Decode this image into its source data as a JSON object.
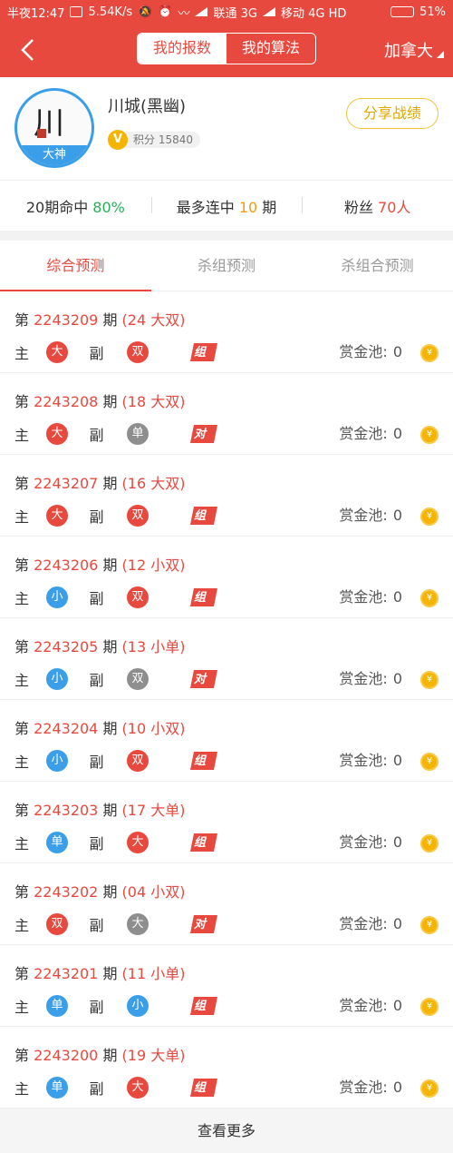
{
  "status_bar": {
    "time": "半夜12:47",
    "speed": "5.54K/s",
    "carrier1": "联通 3G",
    "carrier2": "移动 4G HD",
    "battery": "51%",
    "battery_level": 0.51
  },
  "navbar": {
    "tab_mine": "我的报数",
    "tab_algo": "我的算法",
    "region": "加拿大"
  },
  "profile": {
    "name": "川城(黑幽)",
    "avatar_tag": "大神",
    "avatar_art": "川",
    "badge": "V",
    "score_text": "积分 15840",
    "share": "分享战绩"
  },
  "stats": {
    "hit_prefix": "20期命中 ",
    "hit_value": "80%",
    "streak_prefix": "最多连中 ",
    "streak_value": "10",
    "streak_suffix": " 期",
    "fans_prefix": "粉丝 ",
    "fans_value": "70人"
  },
  "tabs": [
    "综合预测",
    "杀组预测",
    "杀组合预测"
  ],
  "labels": {
    "issue_prefix": "第 ",
    "issue_suffix": " 期",
    "main": "主",
    "vice": "副",
    "pool": "赏金池:",
    "coin": "¥"
  },
  "colors": {
    "red_ball": "#e8493f",
    "blue_ball": "#3a9fe8",
    "gray_ball": "#8e8e8e",
    "brand": "#e8493f"
  },
  "items": [
    {
      "issue": "2243209",
      "result": "(24 大双)",
      "main": "大",
      "main_color": "red",
      "vice": "双",
      "vice_color": "red",
      "flag": "组",
      "pool": "0"
    },
    {
      "issue": "2243208",
      "result": "(18 大双)",
      "main": "大",
      "main_color": "red",
      "vice": "单",
      "vice_color": "gray",
      "flag": "对",
      "pool": "0"
    },
    {
      "issue": "2243207",
      "result": "(16 大双)",
      "main": "大",
      "main_color": "red",
      "vice": "双",
      "vice_color": "red",
      "flag": "组",
      "pool": "0"
    },
    {
      "issue": "2243206",
      "result": "(12 小双)",
      "main": "小",
      "main_color": "blue",
      "vice": "双",
      "vice_color": "red",
      "flag": "组",
      "pool": "0"
    },
    {
      "issue": "2243205",
      "result": "(13 小单)",
      "main": "小",
      "main_color": "blue",
      "vice": "双",
      "vice_color": "gray",
      "flag": "对",
      "pool": "0"
    },
    {
      "issue": "2243204",
      "result": "(10 小双)",
      "main": "小",
      "main_color": "blue",
      "vice": "双",
      "vice_color": "red",
      "flag": "组",
      "pool": "0"
    },
    {
      "issue": "2243203",
      "result": "(17 大单)",
      "main": "单",
      "main_color": "blue",
      "vice": "大",
      "vice_color": "red",
      "flag": "组",
      "pool": "0"
    },
    {
      "issue": "2243202",
      "result": "(04 小双)",
      "main": "双",
      "main_color": "red",
      "vice": "大",
      "vice_color": "gray",
      "flag": "对",
      "pool": "0"
    },
    {
      "issue": "2243201",
      "result": "(11 小单)",
      "main": "单",
      "main_color": "blue",
      "vice": "小",
      "vice_color": "blue",
      "flag": "组",
      "pool": "0"
    },
    {
      "issue": "2243200",
      "result": "(19 大单)",
      "main": "单",
      "main_color": "blue",
      "vice": "大",
      "vice_color": "red",
      "flag": "组",
      "pool": "0"
    }
  ],
  "more": "查看更多"
}
